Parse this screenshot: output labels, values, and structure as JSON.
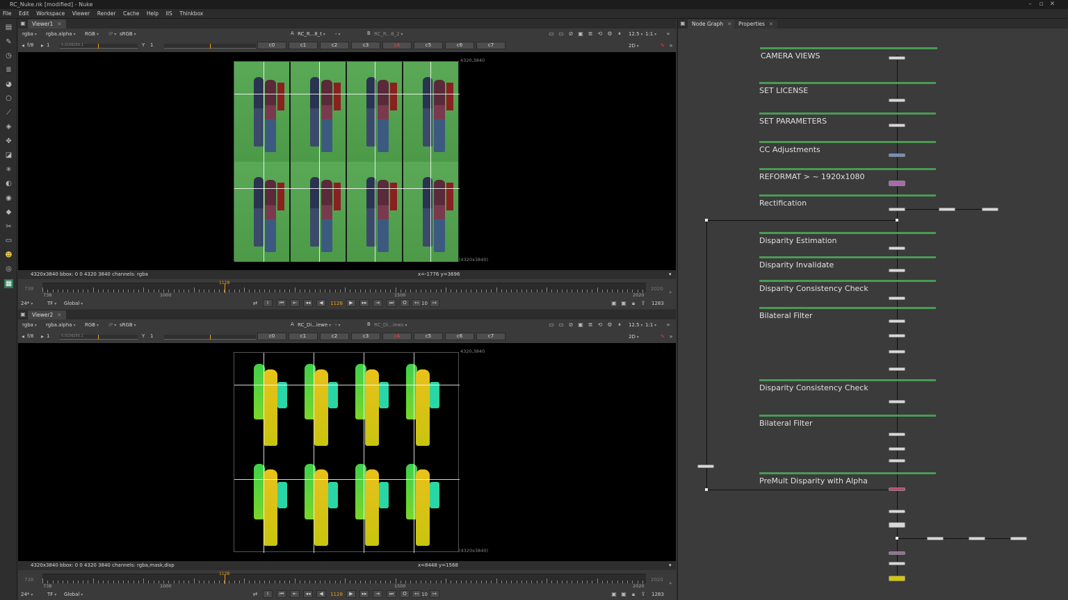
{
  "window": {
    "title": "RC_Nuke.nk [modified] - Nuke"
  },
  "menu": [
    "File",
    "Edit",
    "Workspace",
    "Viewer",
    "Render",
    "Cache",
    "Help",
    "IIS",
    "Thinkbox"
  ],
  "toolbar_icons": [
    "viewer-icon",
    "paint-icon",
    "time-icon",
    "channel-icon",
    "color-icon",
    "filter-icon",
    "keyer-icon",
    "merge-icon",
    "transform-icon",
    "3d-icon",
    "particles-icon",
    "deep-icon",
    "views-icon",
    "metadata-icon",
    "toolsets-icon",
    "other-icon",
    "furnace-icon",
    "ocula-icon",
    "cara-icon",
    "nodes-icon"
  ],
  "viewer1": {
    "tab": "Viewer1",
    "channels": "rgba",
    "alpha": "rgba.alpha",
    "colorspace_rgb": "RGB",
    "lut": "sRGB",
    "input_a_label": "A",
    "input_a": "RC_R...8_t",
    "input_a_op": "-",
    "input_b_label": "B",
    "input_b": "RC_R...8_2",
    "zoom": "12.5",
    "ratio": "1:1",
    "fstop": "f/8",
    "gain": "1",
    "gamma_label": "Y",
    "gamma": "1",
    "gain_ticks": "0.0156250.1",
    "mode": "2D",
    "channel_buttons": [
      "c0",
      "c1",
      "c2",
      "c3",
      "c4",
      "c5",
      "c6",
      "c7"
    ],
    "active_channel": "c4",
    "format_corner": "4320,3840",
    "format_bottom": "(4320x3840)",
    "info_left": "4320x3840  bbox: 0 0 4320 3840 channels: rgba",
    "info_coords": "x=-1776 y=3696",
    "timeline": {
      "start": "738",
      "end": "2020",
      "current": "1128",
      "mark_1000": "1000",
      "mark_1500": "1500",
      "label_in": "738",
      "label_out": "2020"
    },
    "playback": {
      "fps": "24*",
      "tf": "TF",
      "global": "Global",
      "frame": "1128",
      "step": "10",
      "end_frame": "1283"
    }
  },
  "viewer2": {
    "tab": "Viewer2",
    "channels": "rgba",
    "alpha": "rgba.alpha",
    "colorspace_rgb": "RGB",
    "lut": "sRGB",
    "input_a_label": "A",
    "input_a": "RC_Di...iewe",
    "input_a_op": "-",
    "input_b_label": "B",
    "input_b": "RC_Di...iews",
    "zoom": "12.5",
    "ratio": "1:1",
    "fstop": "f/8",
    "gain": "1",
    "gamma_label": "Y",
    "gamma": "1",
    "gain_ticks": "0.0156250.1",
    "mode": "2D",
    "channel_buttons": [
      "c0",
      "c1",
      "c2",
      "c3",
      "c4",
      "c5",
      "c6",
      "c7"
    ],
    "active_channel": "c4",
    "format_corner": "4320,3840",
    "format_bottom": "(4320x3840)",
    "info_left": "4320x3840  bbox: 0 0 4320 3840 channels: rgba,mask,disp",
    "info_coords": "x=8448 y=1568",
    "timeline": {
      "start": "738",
      "end": "2020",
      "current": "1128",
      "mark_1000": "1000",
      "mark_1500": "1500",
      "label_in": "738",
      "label_out": "2020"
    },
    "playback": {
      "fps": "24*",
      "tf": "TF",
      "global": "Global",
      "frame": "1128",
      "step": "10",
      "end_frame": "1283"
    }
  },
  "node_graph": {
    "tabs": [
      "Node Graph",
      "Properties"
    ],
    "backdrops": [
      "CAMERA VIEWS",
      "SET LICENSE",
      "SET PARAMETERS",
      "CC Adjustments",
      "REFORMAT > ~ 1920x1080",
      "Rectification",
      "Disparity Estimation",
      "Disparity Invalidate",
      "Disparity Consistency Check",
      "Bilateral Filter",
      "Disparity Consistency Check",
      "Bilateral Filter",
      "PreMult Disparity with Alpha"
    ],
    "node_colors": {
      "default": "#d8d8d8",
      "cc": "#6d8fc7",
      "reformat": "#a86aa8",
      "premult": "#c8456e",
      "final_purple": "#9a6a9a",
      "final_yellow": "#d6c600"
    }
  },
  "colors": {
    "accent_orange": "#f39c12",
    "backdrop_green": "#4a9b52",
    "active_red": "#ff4040"
  }
}
